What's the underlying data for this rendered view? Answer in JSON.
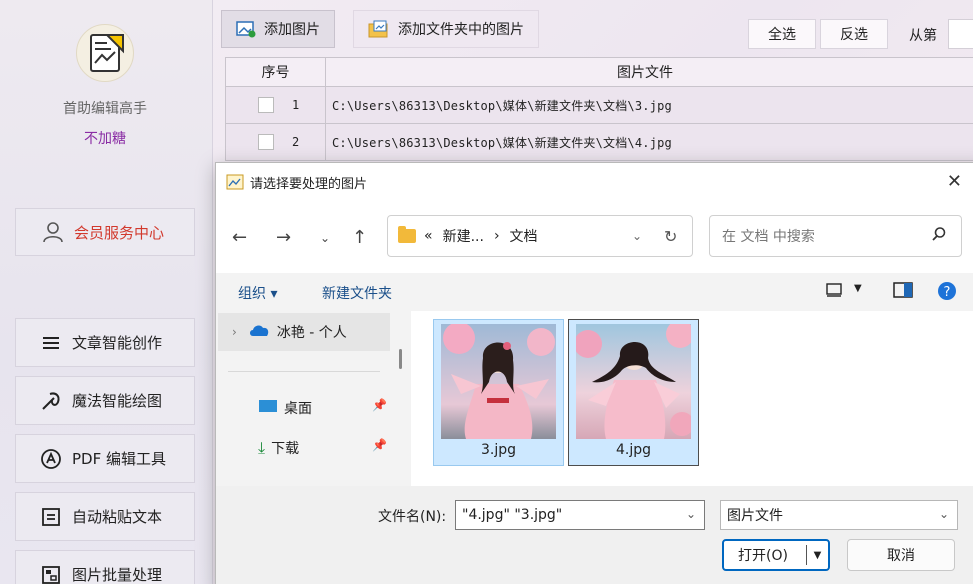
{
  "sidebar": {
    "app_name": "首助编辑高手",
    "app_sub": "不加糖",
    "vip_label": "会员服务中心",
    "items": [
      {
        "label": "文章智能创作",
        "icon": "menu-lines-icon"
      },
      {
        "label": "魔法智能绘图",
        "icon": "magic-wand-icon"
      },
      {
        "label": "PDF 编辑工具",
        "icon": "pdf-icon"
      },
      {
        "label": "自动粘贴文本",
        "icon": "paste-icon"
      },
      {
        "label": "图片批量处理",
        "icon": "image-batch-icon"
      }
    ]
  },
  "toolbar": {
    "add_image": "添加图片",
    "add_folder_images": "添加文件夹中的图片",
    "select_all": "全选",
    "invert_select": "反选",
    "from_label": "从第"
  },
  "table": {
    "headers": [
      "序号",
      "图片文件"
    ],
    "rows": [
      {
        "index": "1",
        "path": "C:\\Users\\86313\\Desktop\\媒体\\新建文件夹\\文档\\3.jpg"
      },
      {
        "index": "2",
        "path": "C:\\Users\\86313\\Desktop\\媒体\\新建文件夹\\文档\\4.jpg"
      }
    ]
  },
  "dialog": {
    "title": "请选择要处理的图片",
    "address": {
      "prefix": "«",
      "parent": "新建...",
      "sep": "›",
      "current": "文档"
    },
    "search_placeholder": "在 文档 中搜索",
    "organize": "组织 ▾",
    "new_folder": "新建文件夹",
    "tree": {
      "cloud": "冰艳 - 个人",
      "items": [
        "桌面",
        "下载"
      ]
    },
    "files": [
      {
        "name": "3.jpg"
      },
      {
        "name": "4.jpg"
      }
    ],
    "filename_label": "文件名(N):",
    "filename_value": "\"4.jpg\" \"3.jpg\"",
    "filetype": "图片文件",
    "open_label": "打开(O)",
    "cancel_label": "取消"
  },
  "colors": {
    "accent": "#0067c0",
    "vip_red": "#d2392d",
    "brand_purple": "#8a2ca4",
    "selection_blue": "#cde8ff"
  }
}
